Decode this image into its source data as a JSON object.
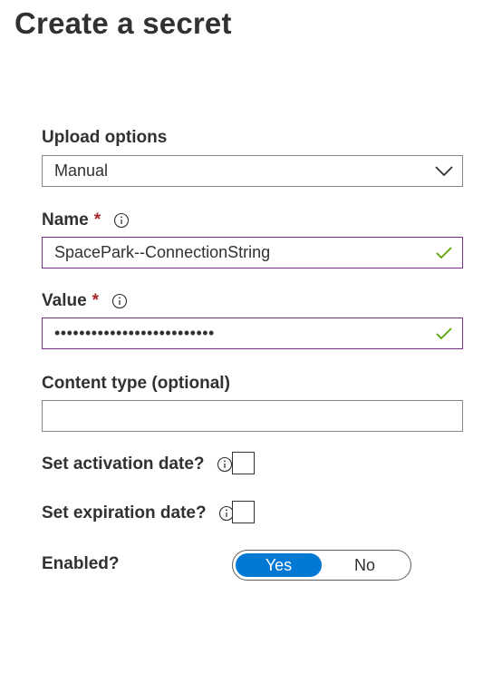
{
  "page": {
    "title": "Create a secret"
  },
  "form": {
    "upload_options": {
      "label": "Upload options",
      "selected": "Manual"
    },
    "name": {
      "label": "Name",
      "required_mark": "*",
      "value": "SpacePark--ConnectionString"
    },
    "value": {
      "label": "Value",
      "required_mark": "*",
      "masked_value": "••••••••••••••••••••••••••"
    },
    "content_type": {
      "label": "Content type (optional)",
      "value": ""
    },
    "activation_date": {
      "label": "Set activation date?",
      "checked": false
    },
    "expiration_date": {
      "label": "Set expiration date?",
      "checked": false
    },
    "enabled": {
      "label": "Enabled?",
      "options": [
        "Yes",
        "No"
      ],
      "selected": "Yes"
    }
  },
  "icons": {
    "info": "info-icon",
    "dropdown": "chevron-down-icon",
    "valid": "checkmark-icon"
  },
  "colors": {
    "required": "#a4262c",
    "focus_border": "#7a2d8c",
    "valid_check": "#57a300",
    "toggle_selected": "#0078d4",
    "text": "#323130"
  }
}
